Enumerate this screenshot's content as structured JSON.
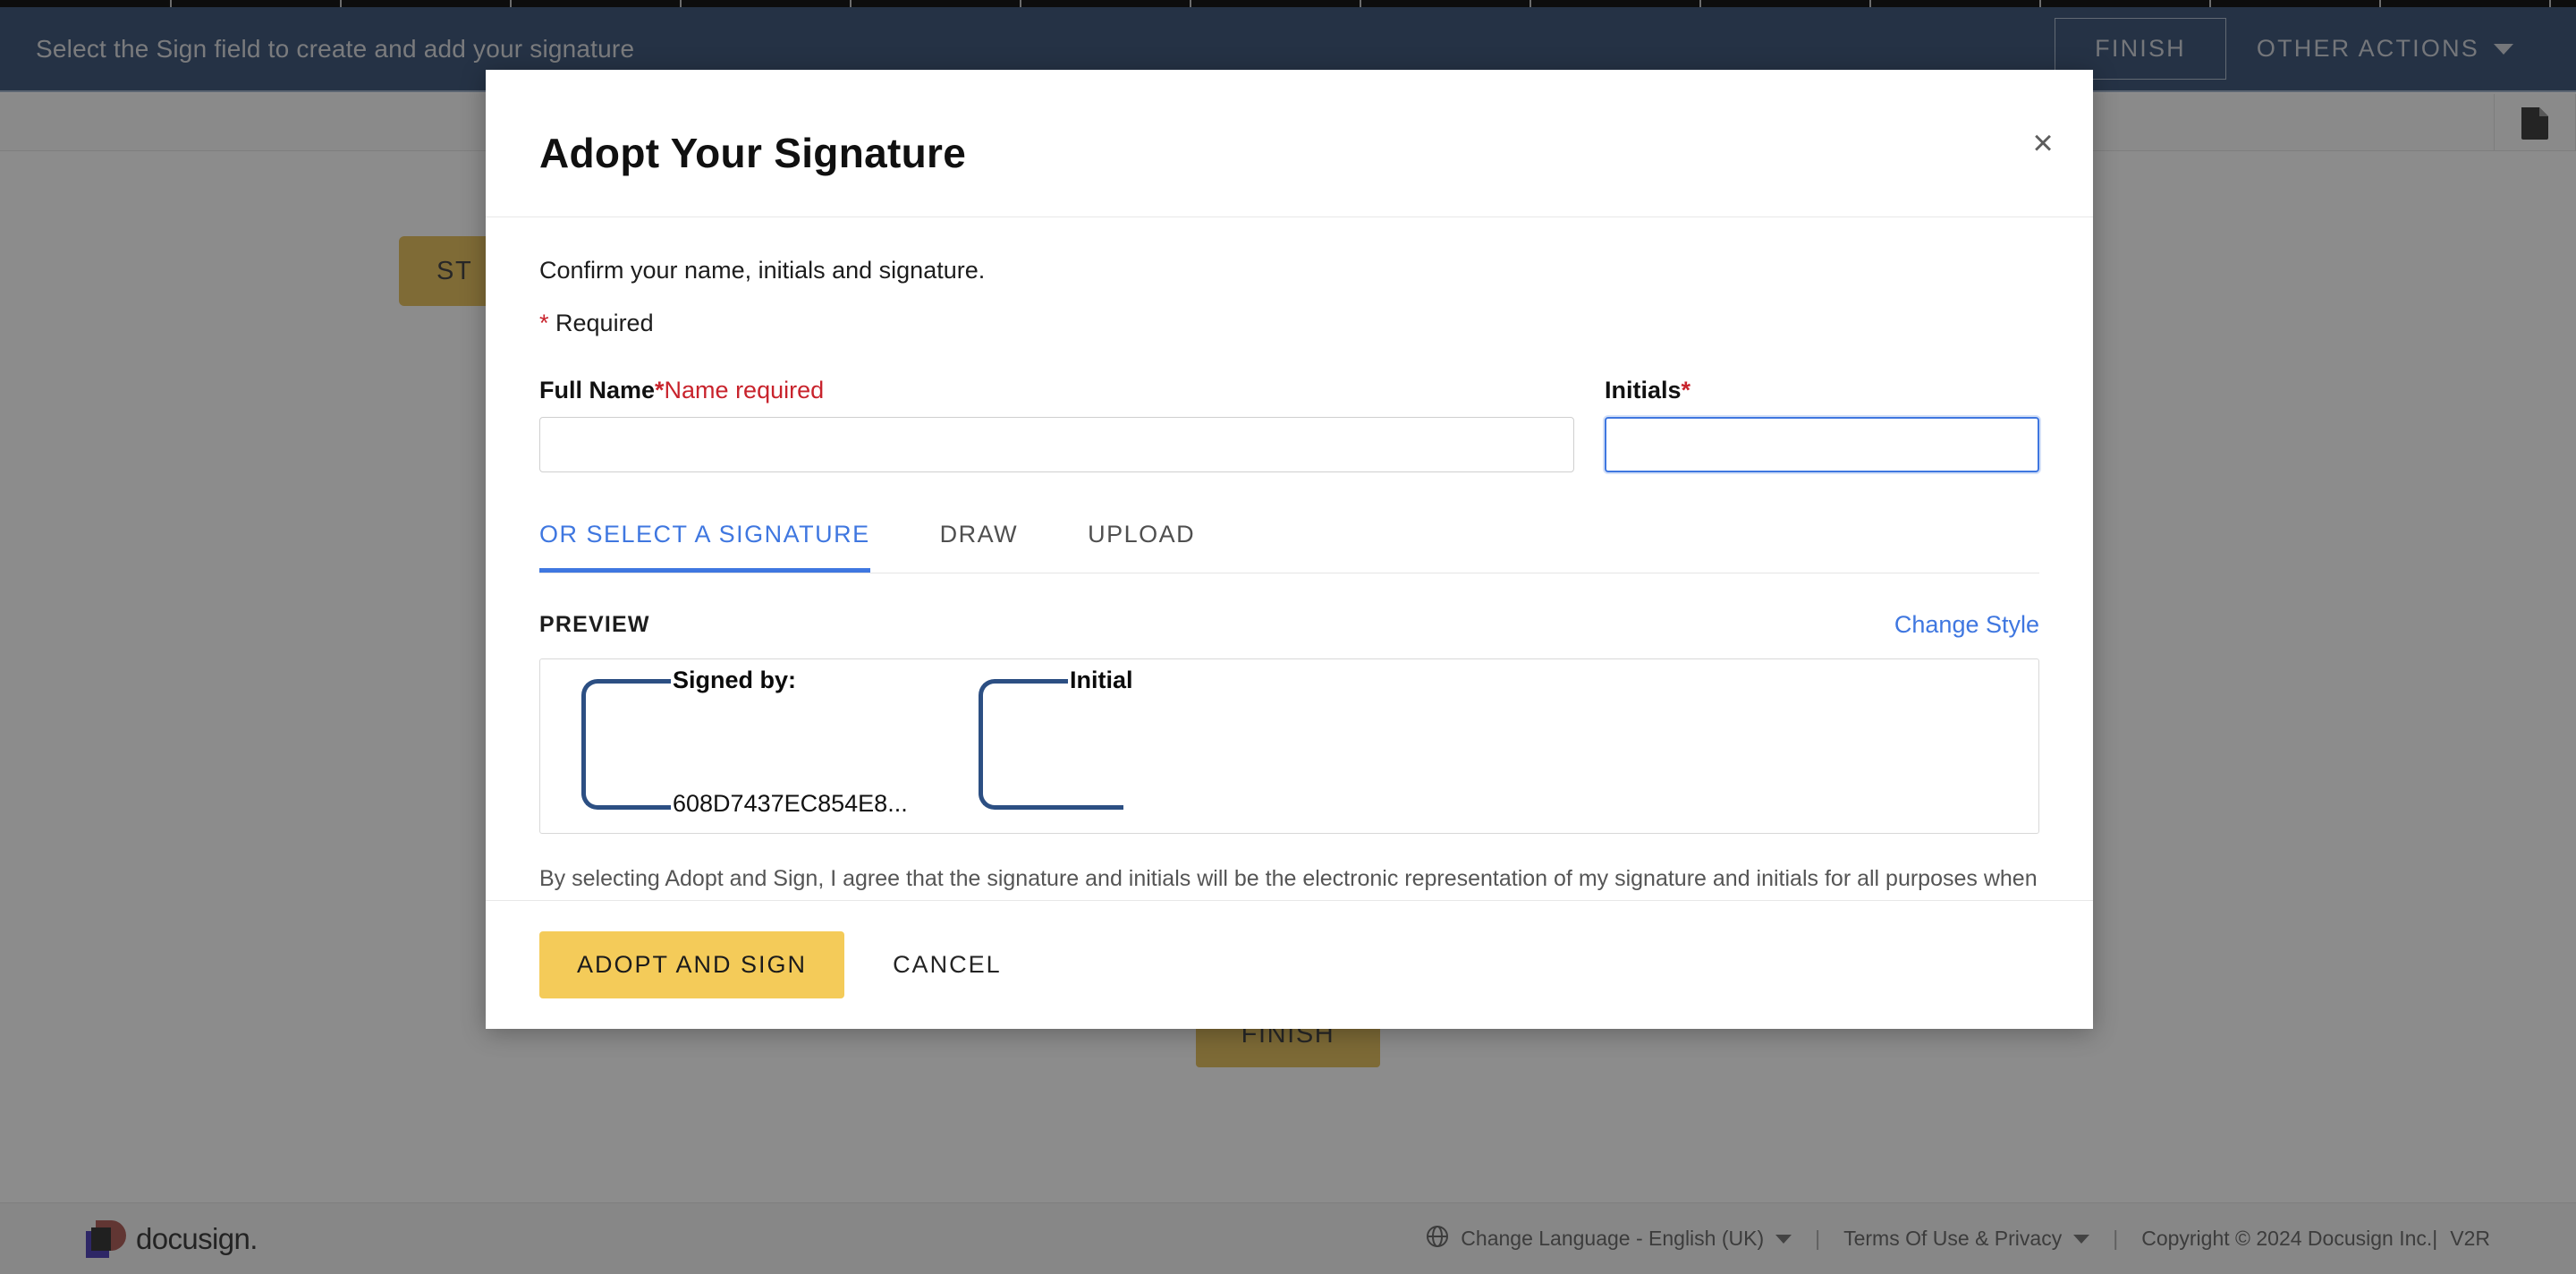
{
  "header": {
    "banner_text": "Select the Sign field to create and add your signature",
    "finish_label": "FINISH",
    "other_actions_label": "OTHER ACTIONS"
  },
  "document": {
    "start_tag_label": "ST",
    "finish_tag_label": "FINISH",
    "page_icon": "document-page-icon"
  },
  "modal": {
    "title": "Adopt Your Signature",
    "close_label": "×",
    "instructions": "Confirm your name, initials and signature.",
    "required_star": "*",
    "required_legend": " Required",
    "full_name": {
      "label": "Full Name",
      "star": "*",
      "error": "Name required",
      "value": "",
      "placeholder": ""
    },
    "initials": {
      "label": "Initials",
      "star": "*",
      "value": "",
      "placeholder": "",
      "focused": true
    },
    "tabs": [
      {
        "label": "OR SELECT A SIGNATURE",
        "active": true
      },
      {
        "label": "DRAW",
        "active": false
      },
      {
        "label": "UPLOAD",
        "active": false
      }
    ],
    "preview": {
      "label": "PREVIEW",
      "change_style_label": "Change Style",
      "signature": {
        "top_text": "Signed by:",
        "bottom_text": "608D7437EC854E8..."
      },
      "initial": {
        "top_text": "Initial",
        "bottom_text": ""
      }
    },
    "consent_text": "By selecting Adopt and Sign, I agree that the signature and initials will be the electronic representation of my signature and initials for all purposes when I (or my agent) use them on documents, including legally binding contracts.",
    "adopt_label": "ADOPT AND SIGN",
    "cancel_label": "CANCEL"
  },
  "footer": {
    "logo_word": "docusign.",
    "language_label": "Change Language - English (UK)",
    "terms_label": "Terms Of Use & Privacy",
    "copyright": "Copyright © 2024 Docusign Inc.|",
    "version": "V2R",
    "separator": "|",
    "globe_icon": "globe-icon"
  },
  "colors": {
    "header_blue": "#15325f",
    "accent_blue": "#3f77e0",
    "brand_yellow": "#f4cb59",
    "tag_yellow": "#e2b33c",
    "error_red": "#c8232c",
    "signature_navy": "#2c4f83"
  }
}
